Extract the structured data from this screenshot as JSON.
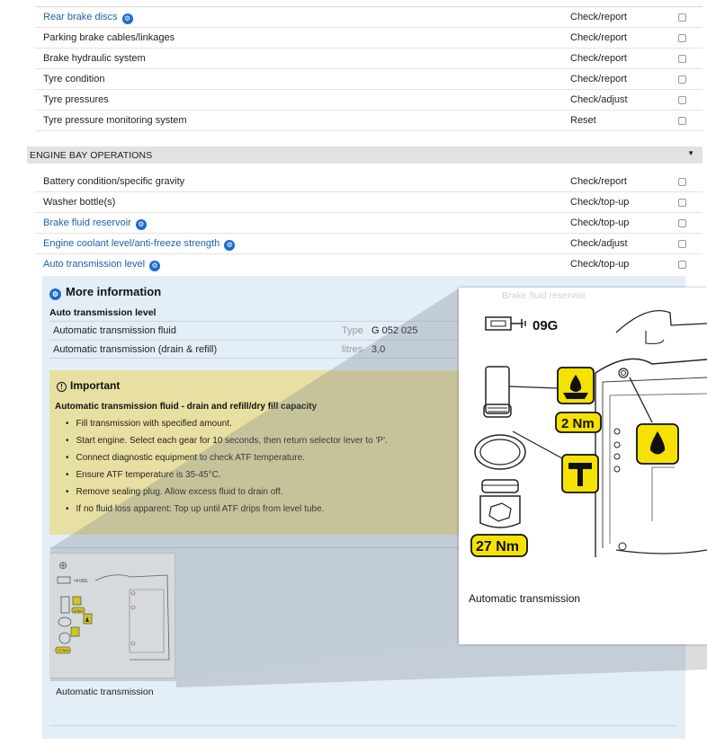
{
  "rows_top": [
    {
      "name": "Rear brake discs",
      "link": true,
      "wrench": true,
      "action": "Check/report"
    },
    {
      "name": "Parking brake cables/linkages",
      "link": false,
      "wrench": false,
      "action": "Check/report"
    },
    {
      "name": "Brake hydraulic system",
      "link": false,
      "wrench": false,
      "action": "Check/report"
    },
    {
      "name": "Tyre condition",
      "link": false,
      "wrench": false,
      "action": "Check/report"
    },
    {
      "name": "Tyre pressures",
      "link": false,
      "wrench": false,
      "action": "Check/adjust"
    },
    {
      "name": "Tyre pressure monitoring system",
      "link": false,
      "wrench": false,
      "action": "Reset"
    }
  ],
  "section": {
    "title": "ENGINE BAY OPERATIONS"
  },
  "rows_engine": [
    {
      "name": "Battery condition/specific gravity",
      "link": false,
      "wrench": false,
      "action": "Check/report"
    },
    {
      "name": "Washer bottle(s)",
      "link": false,
      "wrench": false,
      "action": "Check/top-up"
    },
    {
      "name": "Brake fluid reservoir",
      "link": true,
      "wrench": true,
      "action": "Check/top-up"
    },
    {
      "name": "Engine coolant level/anti-freeze strength",
      "link": true,
      "wrench": true,
      "action": "Check/adjust"
    },
    {
      "name": "Auto transmission level",
      "link": true,
      "wrench": true,
      "action": "Check/top-up"
    }
  ],
  "more_info": {
    "title": "More information",
    "subtitle": "Auto transmission level",
    "specs": [
      {
        "label": "Automatic transmission fluid",
        "unit": "Type",
        "value": "G 052 025"
      },
      {
        "label": "Automatic transmission (drain & refill)",
        "unit": "litres",
        "value": "3,0"
      }
    ],
    "important": {
      "title": "Important",
      "subtitle": "Automatic transmission fluid - drain and refill/dry fill capacity",
      "steps": [
        "Fill transmission with specified amount.",
        "Start engine. Select each gear for 10 seconds, then return selector lever to 'P'.",
        "Connect diagnostic equipment to check ATF temperature.",
        "Ensure ATF temperature is 35-45°C.",
        "Remove sealing plug. Allow excess fluid to drain off.",
        "If no fluid loss apparent: Top up until ATF drips from level tube."
      ]
    },
    "image_caption": "Automatic transmission"
  },
  "zoom": {
    "faint_label": "Brake fluid reservoir",
    "code": "09G",
    "torque_small": "2 Nm",
    "torque_large": "27 Nm",
    "caption": "Automatic transmission"
  },
  "colors": {
    "link": "#1f5fa8",
    "wrench": "#1f6ad1",
    "panel": "#e4eef7",
    "important": "#e8e0a2",
    "callout": "#f5e200"
  }
}
